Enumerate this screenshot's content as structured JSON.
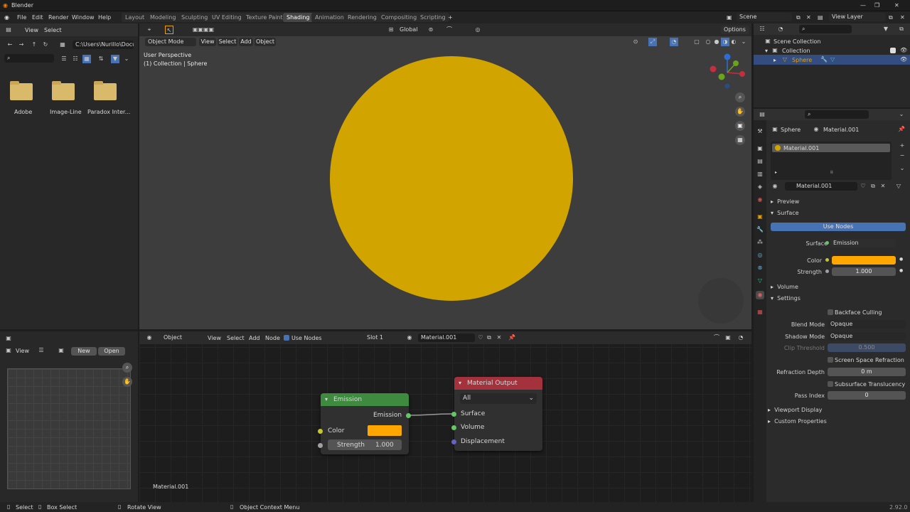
{
  "app": {
    "title": "Blender",
    "version": "2.92.0"
  },
  "menus": [
    "File",
    "Edit",
    "Render",
    "Window",
    "Help"
  ],
  "workspaces": [
    "Layout",
    "Modeling",
    "Sculpting",
    "UV Editing",
    "Texture Paint",
    "Shading",
    "Animation",
    "Rendering",
    "Compositing",
    "Scripting"
  ],
  "top_right": {
    "scene": "Scene",
    "view_layer": "View Layer"
  },
  "file_browser": {
    "menu_view": "View",
    "menu_select": "Select",
    "path": "C:\\Users\\Nurillo\\Docu...",
    "folders": [
      "Adobe",
      "Image-Line",
      "Paradox Inter..."
    ]
  },
  "viewport": {
    "mode": "Object Mode",
    "menus": [
      "View",
      "Select",
      "Add",
      "Object"
    ],
    "transform": "Global",
    "options": "Options",
    "info_line1": "User Perspective",
    "info_line2": "(1) Collection | Sphere",
    "sphere_color": "#d1a400",
    "gizmo": {
      "x": "X",
      "y": "Y",
      "z": "Z"
    }
  },
  "image_editor": {
    "view": "View",
    "new": "New",
    "open": "Open"
  },
  "node_editor": {
    "object_type": "Object",
    "menus": [
      "View",
      "Select",
      "Add",
      "Node"
    ],
    "use_nodes": "Use Nodes",
    "slot": "Slot 1",
    "material": "Material.001",
    "label_bottom": "Material.001",
    "emission_node": {
      "title": "Emission",
      "output": "Emission",
      "color_label": "Color",
      "strength_label": "Strength",
      "strength_value": "1.000",
      "color": "#ffa700"
    },
    "output_node": {
      "title": "Material Output",
      "target": "All",
      "surface": "Surface",
      "volume": "Volume",
      "displacement": "Displacement"
    }
  },
  "outliner": {
    "scene_collection": "Scene Collection",
    "collection": "Collection",
    "object": "Sphere"
  },
  "properties": {
    "object": "Sphere",
    "material_top": "Material.001",
    "slot_item": "Material.001",
    "material_name": "Material.001",
    "preview": "Preview",
    "surface": "Surface",
    "use_nodes": "Use Nodes",
    "surface_label": "Surface",
    "surface_value": "Emission",
    "color_label": "Color",
    "strength_label": "Strength",
    "strength_value": "1.000",
    "volume": "Volume",
    "settings": "Settings",
    "backface": "Backface Culling",
    "blend_mode_label": "Blend Mode",
    "blend_mode": "Opaque",
    "shadow_mode_label": "Shadow Mode",
    "shadow_mode": "Opaque",
    "clip_label": "Clip Threshold",
    "clip_value": "0.500",
    "ssr": "Screen Space Refraction",
    "refraction_label": "Refraction Depth",
    "refraction_value": "0 m",
    "sss": "Subsurface Translucency",
    "pass_label": "Pass Index",
    "pass_value": "0",
    "viewport_display": "Viewport Display",
    "custom_props": "Custom Properties"
  },
  "statusbar": {
    "select": "Select",
    "box_select": "Box Select",
    "rotate": "Rotate View",
    "context": "Object Context Menu"
  }
}
